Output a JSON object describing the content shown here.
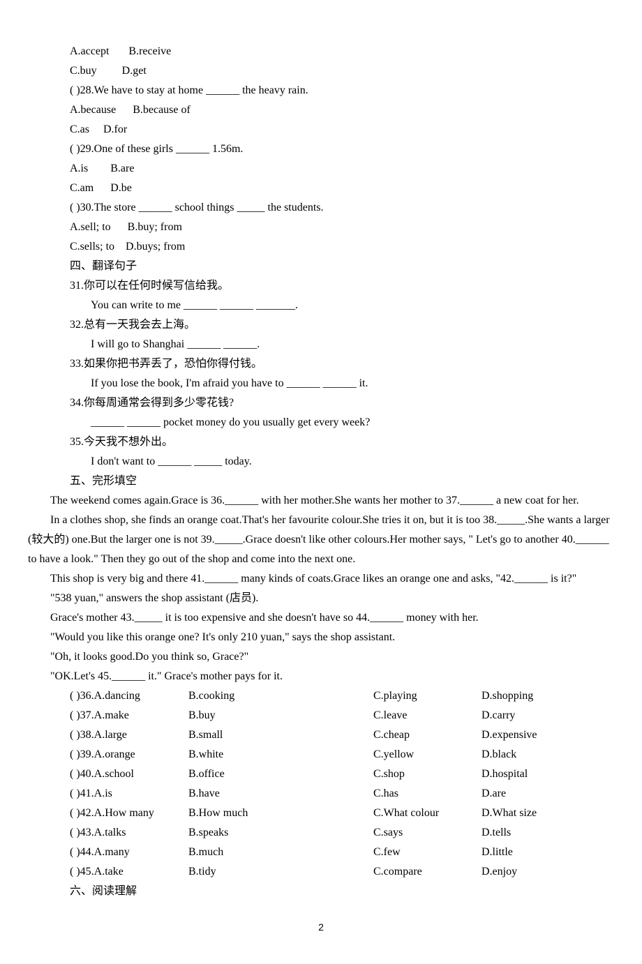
{
  "q27": {
    "a": "A.accept",
    "b": "B.receive",
    "c": "C.buy",
    "d": "D.get"
  },
  "q28": {
    "stem": "(  )28.We have to stay at home ______ the heavy rain.",
    "a": "A.because",
    "b": "B.because of",
    "c": "C.as",
    "d": "D.for"
  },
  "q29": {
    "stem": "(  )29.One of these girls ______ 1.56m.",
    "a": "A.is",
    "b": "B.are",
    "c": "C.am",
    "d": "D.be"
  },
  "q30": {
    "stem": "(  )30.The store ______ school things _____ the students.",
    "a": "A.sell; to",
    "b": "B.buy; from",
    "c": "C.sells; to",
    "d": "D.buys; from"
  },
  "sec4": "四、翻译句子",
  "t31": {
    "zh": "31.你可以在任何时候写信给我。",
    "en": "You can write to me ______ ______ _______."
  },
  "t32": {
    "zh": "32.总有一天我会去上海。",
    "en": "I will go to Shanghai ______ ______."
  },
  "t33": {
    "zh": "33.如果你把书弄丢了，恐怕你得付钱。",
    "en": "If you lose the book, I'm afraid you have to ______ ______ it."
  },
  "t34": {
    "zh": "34.你每周通常会得到多少零花钱?",
    "en": "______ ______ pocket money do you usually get every week?"
  },
  "t35": {
    "zh": "35.今天我不想外出。",
    "en": "I don't want to ______ _____ today."
  },
  "sec5": "五、完形填空",
  "p1": "The weekend comes again.Grace is 36.______ with her mother.She wants her mother to 37.______ a new coat for her.",
  "p2": "In a clothes shop, she finds an orange coat.That's her favourite colour.She tries it on, but it is too 38._____.She wants a larger (较大的) one.But the larger one is not 39._____.Grace doesn't like other colours.Her mother says, \" Let's go to another 40.______ to have a look.\" Then they go out of the shop and come into the next one.",
  "p3": "This shop is very big and there 41.______ many kinds of coats.Grace likes an orange one and asks, \"42.______ is it?\"",
  "p4": "\"538 yuan,\" answers the shop assistant (店员).",
  "p5": "Grace's mother 43._____ it is too expensive and she doesn't have so 44.______ money with her.",
  "p6": "\"Would you like this orange one? It's only 210 yuan,\" says the shop assistant.",
  "p7": "\"Oh, it looks good.Do you think so, Grace?\"",
  "p8": "\"OK.Let's 45.______ it.\" Grace's mother pays for it.",
  "cloze": [
    {
      "q": "(  )36.A.dancing",
      "b": "B.cooking",
      "c": "C.playing",
      "d": "D.shopping"
    },
    {
      "q": "(  )37.A.make",
      "b": "B.buy",
      "c": "C.leave",
      "d": "D.carry"
    },
    {
      "q": "(  )38.A.large",
      "b": "B.small",
      "c": "C.cheap",
      "d": "D.expensive"
    },
    {
      "q": "(  )39.A.orange",
      "b": "B.white",
      "c": "C.yellow",
      "d": "D.black"
    },
    {
      "q": "(  )40.A.school",
      "b": "B.office",
      "c": "C.shop",
      "d": "D.hospital"
    },
    {
      "q": "(  )41.A.is",
      "b": "B.have",
      "c": "C.has",
      "d": "D.are"
    },
    {
      "q": "(  )42.A.How many",
      "b": "B.How much",
      "c": "C.What colour",
      "d": "D.What size"
    },
    {
      "q": "(  )43.A.talks",
      "b": "B.speaks",
      "c": "C.says",
      "d": "D.tells"
    },
    {
      "q": "(  )44.A.many",
      "b": "B.much",
      "c": "C.few",
      "d": "D.little"
    },
    {
      "q": "(  )45.A.take",
      "b": "B.tidy",
      "c": "C.compare",
      "d": "D.enjoy"
    }
  ],
  "sec6": "六、阅读理解",
  "pagenum": "2"
}
